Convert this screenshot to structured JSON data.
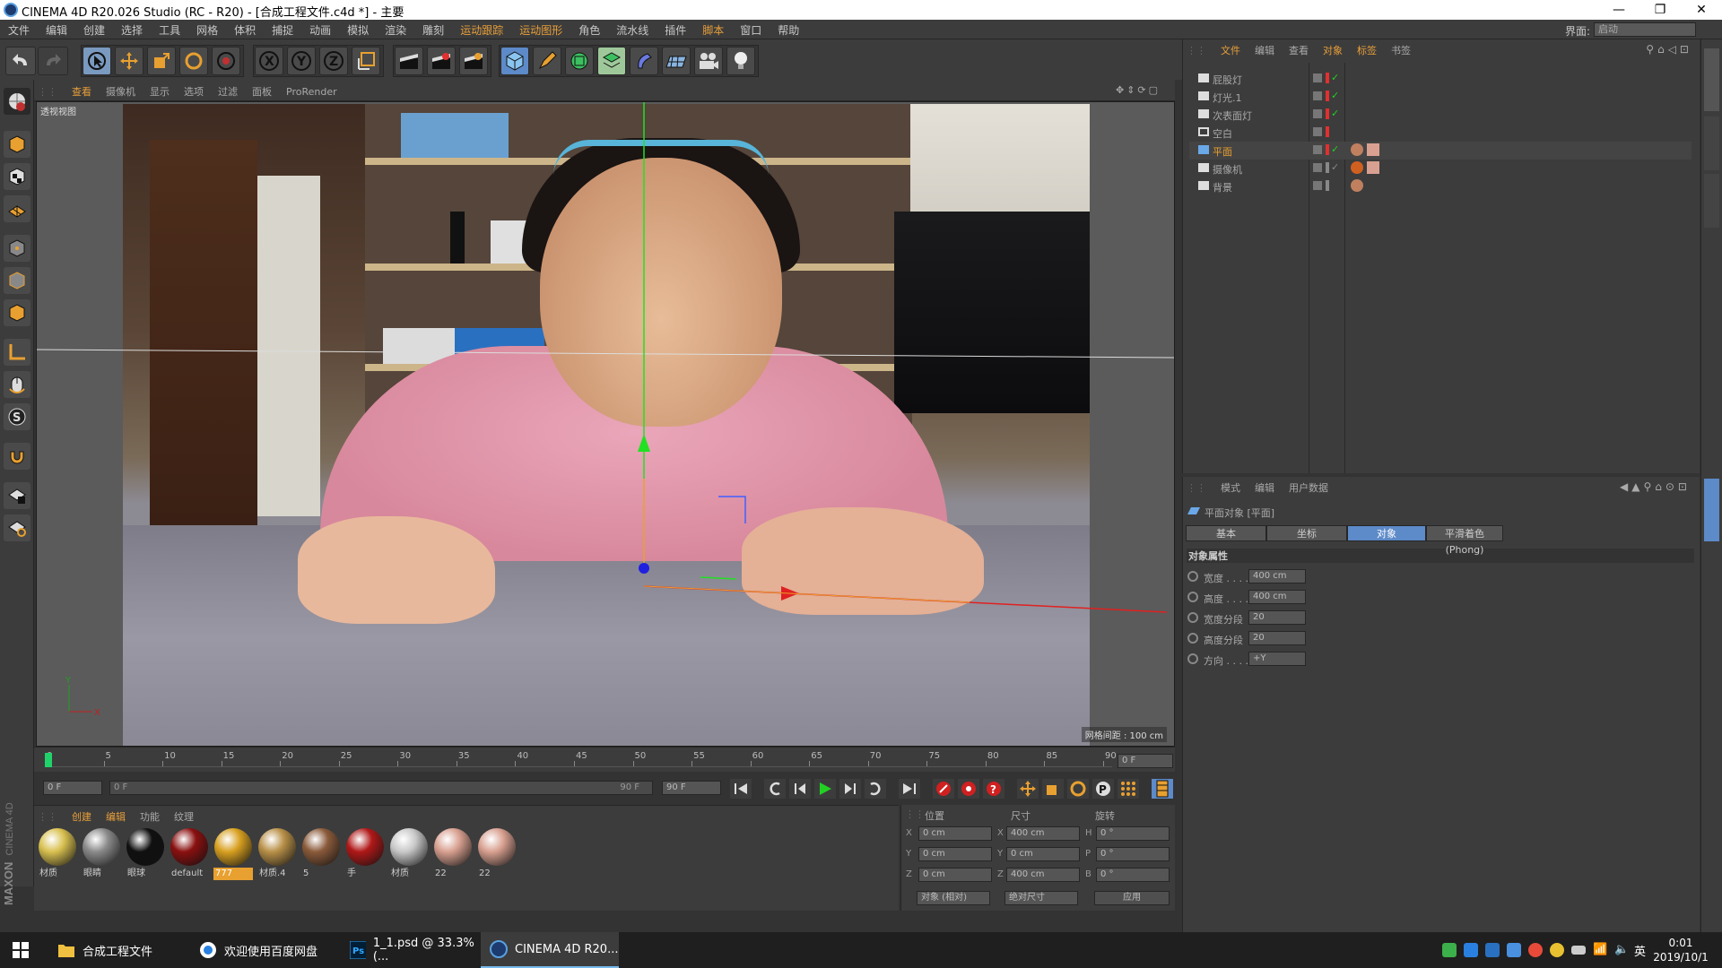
{
  "window": {
    "title": "CINEMA 4D R20.026 Studio (RC - R20) - [合成工程文件.c4d *] - 主要"
  },
  "menubar": {
    "items": [
      "文件",
      "编辑",
      "创建",
      "选择",
      "工具",
      "网格",
      "体积",
      "捕捉",
      "动画",
      "模拟",
      "渲染",
      "雕刻",
      "运动跟踪",
      "运动图形",
      "角色",
      "流水线",
      "插件",
      "脚本",
      "窗口",
      "帮助"
    ],
    "layout_label": "界面:",
    "layout_value": "启动"
  },
  "viewport": {
    "menu": [
      "查看",
      "摄像机",
      "显示",
      "选项",
      "过滤",
      "面板",
      "ProRender"
    ],
    "label": "透视视图",
    "grid_distance": "网格间距 : 100 cm"
  },
  "timeline": {
    "ticks": [
      "0",
      "5",
      "10",
      "15",
      "20",
      "25",
      "30",
      "35",
      "40",
      "45",
      "50",
      "55",
      "60",
      "65",
      "70",
      "75",
      "80",
      "85",
      "90"
    ],
    "end_frame": "0 F",
    "start_field": "0 F",
    "range_start": "0 F",
    "range_end": "90 F",
    "end_field": "90 F"
  },
  "materials": {
    "menu": [
      "创建",
      "编辑",
      "功能",
      "纹理"
    ],
    "items": [
      {
        "label": "材质",
        "color": "#d8c050"
      },
      {
        "label": "眼睛",
        "color": "#8a8a8a"
      },
      {
        "label": "眼球",
        "color": "#101010"
      },
      {
        "label": "default",
        "color": "#8a1010"
      },
      {
        "label": "777",
        "color": "#d8a020"
      },
      {
        "label": "材质.4",
        "color": "#b89048"
      },
      {
        "label": "5",
        "color": "#8a5a3a"
      },
      {
        "label": "手",
        "color": "#b01818"
      },
      {
        "label": "材质",
        "color": "#c8c8c8"
      },
      {
        "label": "22",
        "color": "#d8a090"
      },
      {
        "label": "22",
        "color": "#d8a090"
      }
    ]
  },
  "coords": {
    "headers": [
      "位置",
      "尺寸",
      "旋转"
    ],
    "rows": [
      {
        "axis": "X",
        "pos": "0 cm",
        "sl": "X",
        "size": "400 cm",
        "rl": "H",
        "rot": "0 °"
      },
      {
        "axis": "Y",
        "pos": "0 cm",
        "sl": "Y",
        "size": "0 cm",
        "rl": "P",
        "rot": "0 °"
      },
      {
        "axis": "Z",
        "pos": "0 cm",
        "sl": "Z",
        "size": "400 cm",
        "rl": "B",
        "rot": "0 °"
      }
    ],
    "mode": "对象 (相对)",
    "size_mode": "绝对尺寸",
    "apply": "应用"
  },
  "objects": {
    "menu": [
      "文件",
      "编辑",
      "查看",
      "对象",
      "标签",
      "书签"
    ],
    "items": [
      "屁股灯",
      "灯光.1",
      "次表面灯",
      "空白",
      "平面",
      "摄像机",
      "背景"
    ]
  },
  "attributes": {
    "menu": [
      "模式",
      "编辑",
      "用户数据"
    ],
    "title": "平面对象 [平面]",
    "tabs": [
      "基本",
      "坐标",
      "对象",
      "平滑着色(Phong)"
    ],
    "section": "对象属性",
    "rows": [
      {
        "label": "宽度 . . . .",
        "value": "400 cm"
      },
      {
        "label": "高度 . . . .",
        "value": "400 cm"
      },
      {
        "label": "宽度分段",
        "value": "20"
      },
      {
        "label": "高度分段",
        "value": "20"
      },
      {
        "label": "方向 . . . .",
        "value": "+Y"
      }
    ]
  },
  "brand": {
    "line1": "MAXON",
    "line2": "CINEMA 4D"
  },
  "taskbar": {
    "items": [
      "合成工程文件",
      "欢迎使用百度网盘",
      "1_1.psd @ 33.3%(...",
      "CINEMA 4D R20..."
    ],
    "ime": "英",
    "time": "0:01",
    "date": "2019/10/1"
  }
}
